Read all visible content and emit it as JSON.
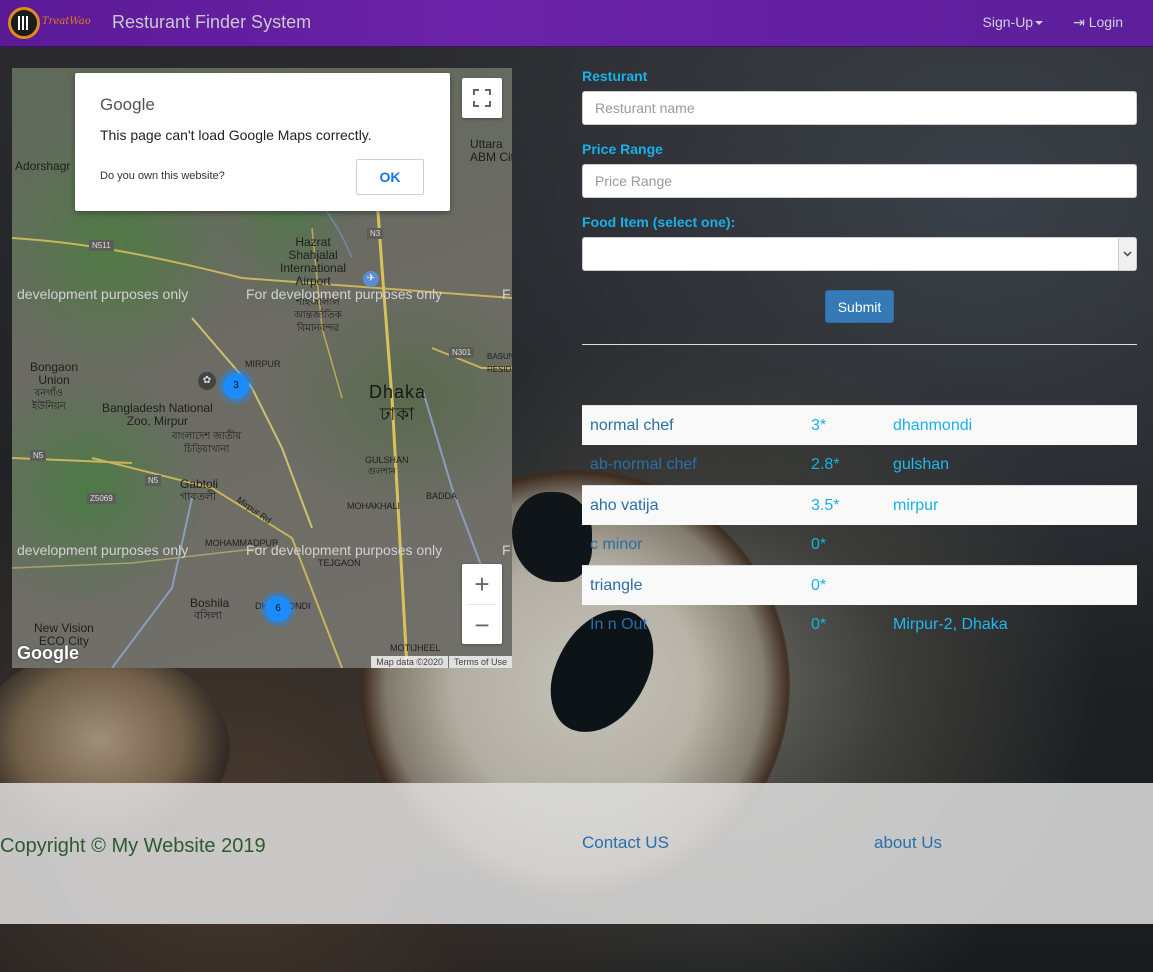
{
  "navbar": {
    "logo_text": "TreatWao",
    "brand": "Resturant Finder System",
    "signup": "Sign-Up",
    "login": "Login"
  },
  "map": {
    "dialog": {
      "google": "Google",
      "message": "This page can't load Google Maps correctly.",
      "question": "Do you own this website?",
      "ok": "OK"
    },
    "dev_text": "development purposes only",
    "dev_text2": "For development purposes only",
    "dev_text3": "F",
    "labels": {
      "adorshagr": "Adorshagr",
      "uttara": "Uttara\nABM City",
      "hazrat": "Hazrat\nShahjalal\nInternational\nAirport",
      "airport_bn": "শাহজালাল\nআন্তর্জাতিক\nবিমানবন্দর",
      "mirpur": "MIRPUR",
      "dhaka": "Dhaka",
      "dhaka_bn": "ঢাকা",
      "bongaon": "Bongaon\nUnion",
      "bongaon_bn": "বনগাঁও\nইউনিয়ন",
      "zoo": "Bangladesh National\nZoo, Mirpur",
      "zoo_bn": "বাংলাদেশ জাতীয়\nচিড়িয়াখানা",
      "gulshan": "GULSHAN",
      "gulshan_bn": "গুলশান",
      "gabtoli": "Gabtoli",
      "gabtoli_bn": "গাবতলী",
      "mohakhali": "MOHAKHALI",
      "badda": "BADDA",
      "mirpur_rd": "Mirpur Rd",
      "mohammadpur": "MOHAMMADPUR",
      "tejgaon": "TEJGAON",
      "boshila": "Boshila",
      "boshila_bn": "বসিলা",
      "dhanmondi": "DHANMONDI",
      "new_vision": "New Vision\nECO City",
      "motijheel": "MOTIJHEEL",
      "basundhara": "BASUN\nRESID"
    },
    "road_tags": [
      "N511",
      "N3",
      "N301",
      "N5",
      "N5",
      "Z5069"
    ],
    "clusters": [
      {
        "count": "3"
      },
      {
        "count": "6"
      }
    ],
    "zoom_in": "+",
    "zoom_out": "−",
    "google_logo": "Google",
    "map_data": "Map data ©2020",
    "terms": "Terms of Use"
  },
  "form": {
    "name_label": "Resturant",
    "name_placeholder": "Resturant name",
    "price_label": "Price Range",
    "price_placeholder": "Price Range",
    "food_label": "Food Item (select one):",
    "food_value": "",
    "submit": "Submit"
  },
  "results": [
    {
      "name": "normal chef",
      "rating": "3*",
      "location": "dhanmondi"
    },
    {
      "name": "ab-normal chef",
      "rating": "2.8*",
      "location": "gulshan"
    },
    {
      "name": "aho vatija",
      "rating": "3.5*",
      "location": "mirpur"
    },
    {
      "name": "c minor",
      "rating": "0*",
      "location": ""
    },
    {
      "name": "triangle",
      "rating": "0*",
      "location": ""
    },
    {
      "name": "In n Out",
      "rating": "0*",
      "location": "Mirpur-2, Dhaka"
    }
  ],
  "footer": {
    "copyright": "Copyright © My Website 2019",
    "contact": "Contact US",
    "about": "about Us"
  }
}
